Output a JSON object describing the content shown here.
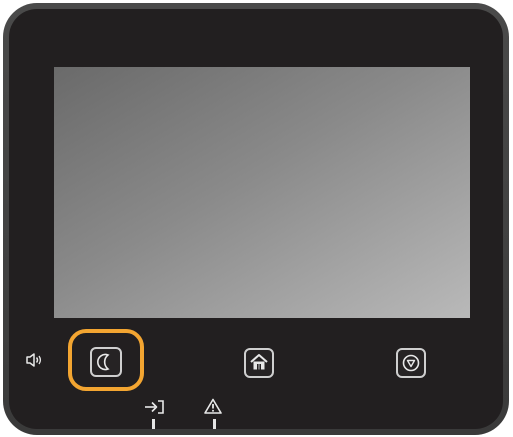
{
  "device": {
    "name": "printer-control-panel"
  },
  "controls": {
    "volume": {
      "icon": "speaker-icon"
    },
    "sleep": {
      "icon": "moon-icon",
      "highlighted": true,
      "highlight_color": "#f3a531"
    },
    "home": {
      "icon": "home-icon"
    },
    "stop": {
      "icon": "stop-icon"
    }
  },
  "indicators": {
    "data": {
      "icon": "data-indicator-icon"
    },
    "error": {
      "icon": "warning-icon"
    }
  },
  "colors": {
    "panel": "#221f20",
    "bezel": "#3f3f3f",
    "highlight": "#f3a531",
    "icon_stroke": "#e8e8e8"
  }
}
